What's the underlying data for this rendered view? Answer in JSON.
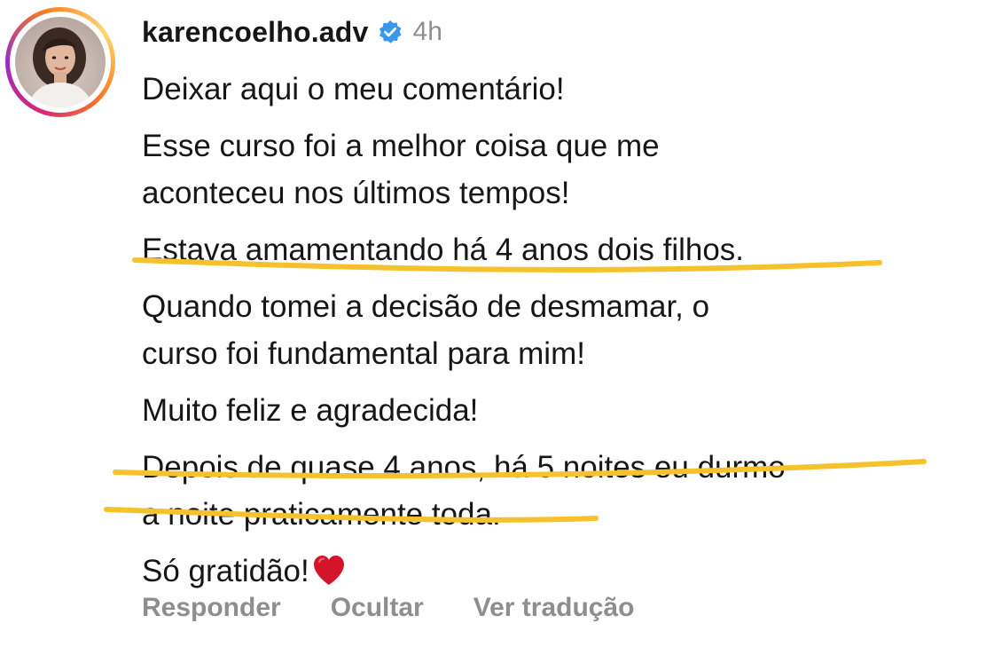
{
  "comment": {
    "username": "karencoelho.adv",
    "verified_icon": "verified-badge-icon",
    "time": "4h",
    "lines": [
      "Deixar aqui o meu comentário!",
      "Esse curso foi a melhor coisa que me",
      "aconteceu nos últimos tempos!",
      "Estava amamentando há 4 anos dois filhos.",
      "Quando tomei a decisão de desmamar, o",
      "curso foi fundamental para mim!",
      "Muito feliz e agradecida!",
      "Depois de quase 4 anos, há 5 noites eu durmo",
      "a noite praticamente toda.",
      "Só gratidão!"
    ],
    "heart_icon": "heart-icon",
    "highlight_color": "#f5c22b"
  },
  "actions": {
    "reply": "Responder",
    "hide": "Ocultar",
    "translate": "Ver tradução"
  },
  "colors": {
    "verified": "#3897f0",
    "muted": "#8e8e8e",
    "heart": "#d3142a"
  }
}
